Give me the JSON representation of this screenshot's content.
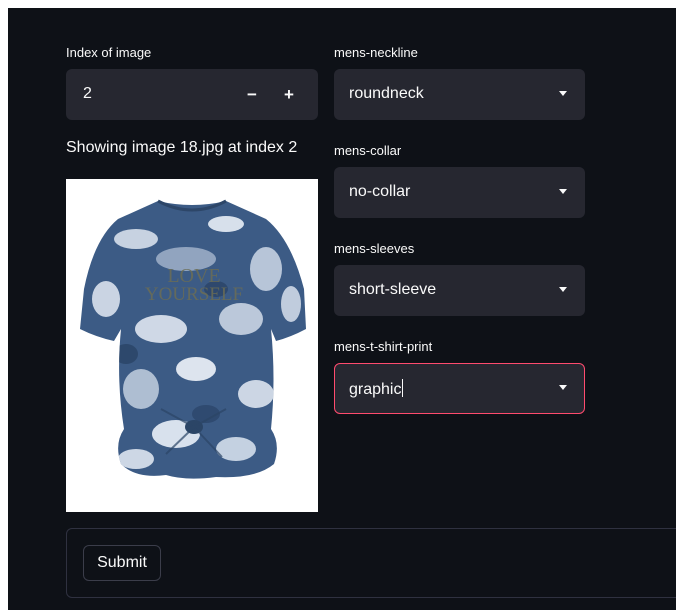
{
  "index_input": {
    "label": "Index of image",
    "value": "2",
    "decrement": "−",
    "increment": "+"
  },
  "caption": "Showing image 18.jpg at index 2",
  "selects": [
    {
      "label": "mens-neckline",
      "value": "roundneck"
    },
    {
      "label": "mens-collar",
      "value": "no-collar"
    },
    {
      "label": "mens-sleeves",
      "value": "short-sleeve"
    },
    {
      "label": "mens-t-shirt-print",
      "value": "graphic"
    }
  ],
  "shirt_print_text": [
    "LOVE",
    "YOURSELF"
  ],
  "submit_label": "Submit",
  "colors": {
    "background": "#0e1117",
    "widget": "#262730",
    "focus_border": "#ff4b6e",
    "shirt": "#3c5b85"
  }
}
